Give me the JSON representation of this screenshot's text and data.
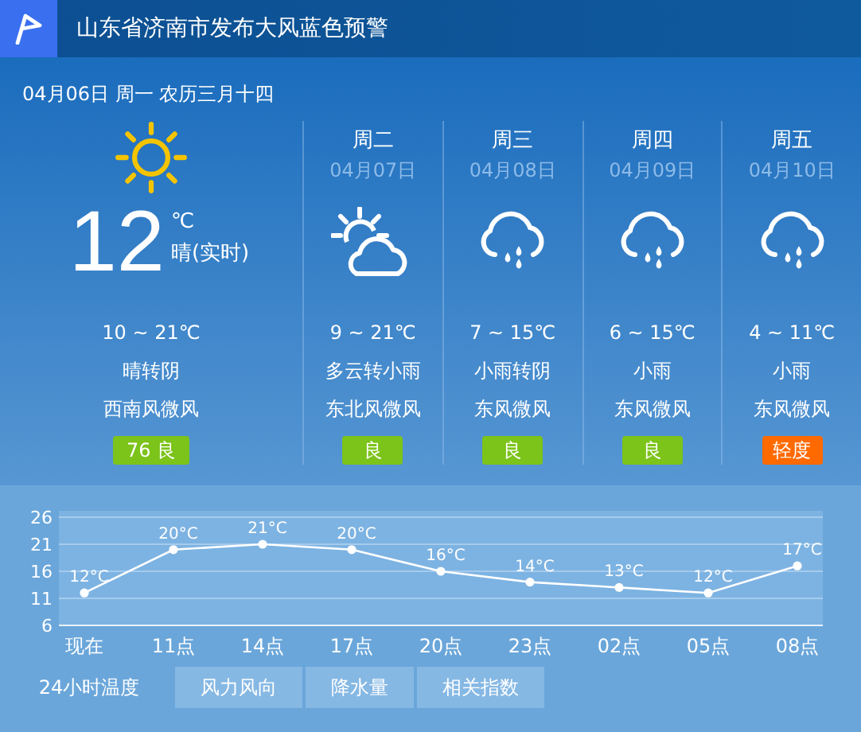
{
  "alert": {
    "title": "山东省济南市发布大风蓝色预警"
  },
  "today": {
    "date_line": "04月06日 周一 农历三月十四",
    "kind": "sunny",
    "temperature": "12",
    "unit": "℃",
    "condition": "晴(实时)",
    "range": "10 ~ 21℃",
    "weather": "晴转阴",
    "wind": "西南风微风",
    "aqi": "76 良",
    "color": "#7cc31a"
  },
  "days": [
    {
      "weekday": "周二",
      "date": "04月07日",
      "kind": "partly_cloudy",
      "range": "9 ~ 21℃",
      "weather": "多云转小雨",
      "wind": "东北风微风",
      "aqi": "良",
      "color": "#7cc31a"
    },
    {
      "weekday": "周三",
      "date": "04月08日",
      "kind": "rain",
      "range": "7 ~ 15℃",
      "weather": "小雨转阴",
      "wind": "东风微风",
      "aqi": "良",
      "color": "#7cc31a"
    },
    {
      "weekday": "周四",
      "date": "04月09日",
      "kind": "rain",
      "range": "6 ~ 15℃",
      "weather": "小雨",
      "wind": "东风微风",
      "aqi": "良",
      "color": "#7cc31a"
    },
    {
      "weekday": "周五",
      "date": "04月10日",
      "kind": "rain",
      "range": "4 ~ 11℃",
      "weather": "小雨",
      "wind": "东风微风",
      "aqi": "轻度",
      "color": "#ff6a00"
    }
  ],
  "chart": {
    "chart_data": {
      "type": "line",
      "categories": [
        "现在",
        "11点",
        "14点",
        "17点",
        "20点",
        "23点",
        "02点",
        "05点",
        "08点"
      ],
      "series": [
        {
          "color": "#ffffff",
          "values": [
            12,
            20,
            21,
            20,
            16,
            14,
            13,
            12,
            17
          ],
          "marker": true
        }
      ],
      "ylim": [
        6,
        26
      ],
      "yticks": [
        6,
        11,
        16,
        21,
        26
      ],
      "grid": true,
      "value_labels": [
        "12°C",
        "20°C",
        "21°C",
        "20°C",
        "16°C",
        "14°C",
        "13°C",
        "12°C",
        "17°C"
      ]
    }
  },
  "tabs": [
    {
      "label": "24小时温度",
      "selected": true
    },
    {
      "label": "风力风向",
      "selected": false
    },
    {
      "label": "降水量",
      "selected": false
    },
    {
      "label": "相关指数",
      "selected": false
    }
  ]
}
